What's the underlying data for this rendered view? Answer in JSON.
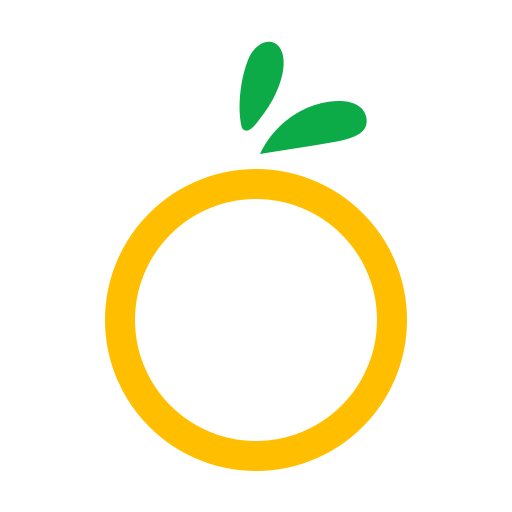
{
  "logo": {
    "icon": "orange-fruit-logo-icon",
    "colors": {
      "ring": "#FFBF00",
      "leaf": "#0CAB47",
      "background": "#FFFFFF"
    }
  }
}
